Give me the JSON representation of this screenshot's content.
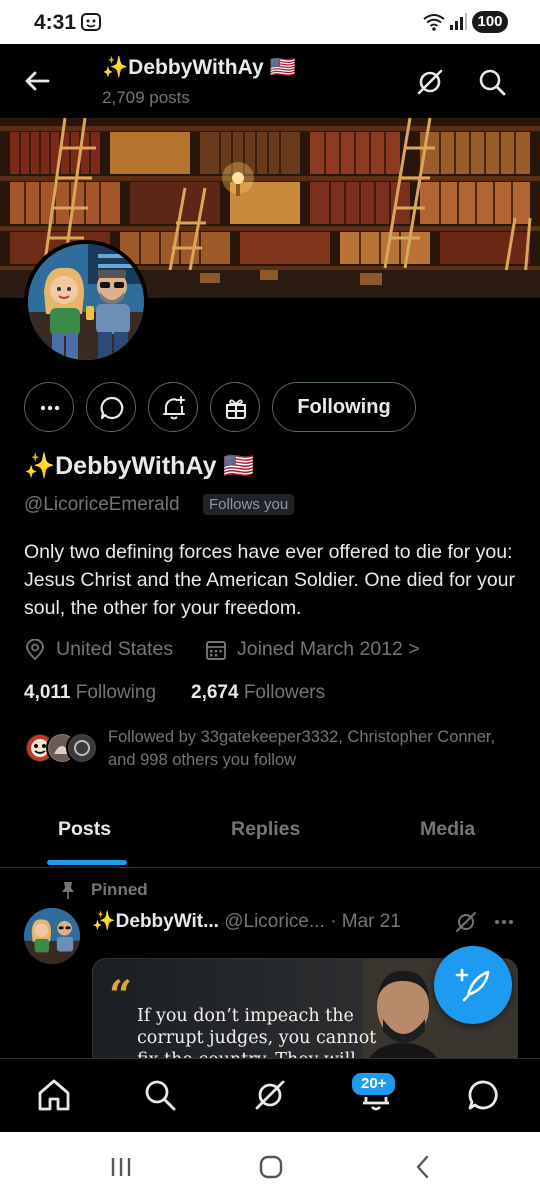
{
  "status_bar": {
    "time": "4:31",
    "battery": "100"
  },
  "header": {
    "name": "✨DebbyWithAy 🇺🇸",
    "post_count": "2,709 posts"
  },
  "profile": {
    "display_name": "✨DebbyWithAy 🇺🇸",
    "handle": "@LicoriceEmerald",
    "follows_you": "Follows you",
    "bio": "Only two defining forces have ever offered to die for you: Jesus Christ and the American Soldier. One died for your soul, the other for your freedom.",
    "location": "United States",
    "joined": "Joined March 2012",
    "joined_chevron": ">",
    "following_count": "4,011",
    "following_label": "Following",
    "followers_count": "2,674",
    "followers_label": "Followers",
    "followed_by": "Followed by 33gatekeeper3332, Christopher Conner, and 998 others you follow"
  },
  "actions": {
    "more": "More",
    "message": "Message",
    "notify": "Notifications",
    "gift": "Gift",
    "following_button": "Following"
  },
  "tabs": [
    {
      "label": "Posts",
      "active": true
    },
    {
      "label": "Replies",
      "active": false
    },
    {
      "label": "Media",
      "active": false
    }
  ],
  "pinned_post": {
    "pinned_label": "Pinned",
    "author_name": "✨DebbyWit...",
    "author_handle": "@Licorice...",
    "date": "· Mar 21",
    "quote_text": "If you don’t impeach the corrupt judges, you cannot fix the country. They will"
  },
  "bottom_nav": {
    "notifications_badge": "20+"
  },
  "colors": {
    "accent": "#1d9bf0",
    "background": "#000000",
    "text": "#e7e9ea",
    "muted": "#71767b"
  },
  "icons": [
    "back-arrow-icon",
    "grok-icon",
    "search-icon",
    "more-dots-icon",
    "message-icon",
    "notification-bell-plus-icon",
    "gift-icon",
    "location-pin-icon",
    "calendar-icon",
    "pin-icon",
    "compose-icon",
    "home-icon",
    "bell-icon",
    "chat-icon"
  ]
}
